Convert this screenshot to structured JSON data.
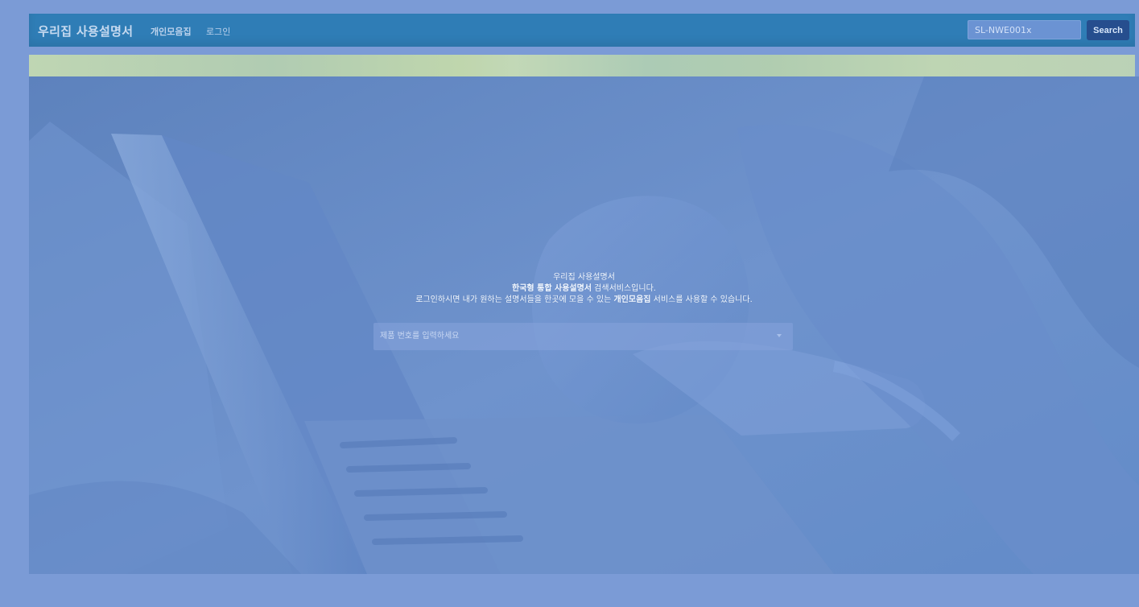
{
  "navbar": {
    "brand": "우리집 사용설명서",
    "links": [
      "개인모음집",
      "로그인"
    ],
    "search": {
      "value": "SL-NWE001x",
      "button_label": "Search"
    }
  },
  "hero": {
    "title": "우리집 사용설명서",
    "line2_prefix": "한국형 통합 사용설명서",
    "line2_suffix": " 검색서비스입니다.",
    "line3_prefix": "로그인하시면 내가 원하는 설명서들을 한곳에 모을 수 있는 ",
    "line3_bold": "개인모음집",
    "line3_suffix": " 서비스를 사용할 수 있습니다.",
    "dropdown_placeholder": "제품 번호를 입력하세요"
  },
  "colors": {
    "page_background": "#7b9bd6",
    "navbar": "#2f7db6",
    "search_button": "#264e8e",
    "hero_overlay": "#6b8fc8"
  },
  "icons": {
    "dropdown": "chevron-down-icon"
  }
}
